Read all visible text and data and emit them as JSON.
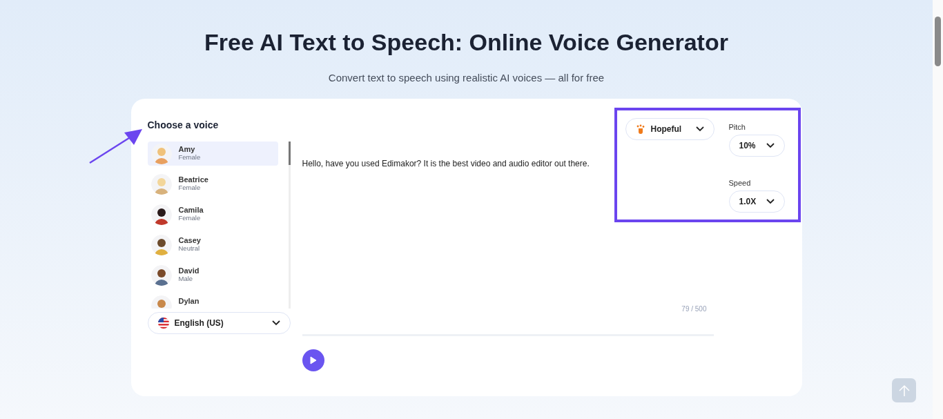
{
  "header": {
    "title": "Free AI Text to Speech: Online Voice Generator",
    "subtitle": "Convert text to speech using realistic AI voices — all for free"
  },
  "voice_panel": {
    "heading": "Choose a voice",
    "voices": [
      {
        "name": "Amy",
        "gender": "Female",
        "selected": true
      },
      {
        "name": "Beatrice",
        "gender": "Female",
        "selected": false
      },
      {
        "name": "Camila",
        "gender": "Female",
        "selected": false
      },
      {
        "name": "Casey",
        "gender": "Neutral",
        "selected": false
      },
      {
        "name": "David",
        "gender": "Male",
        "selected": false
      },
      {
        "name": "Dylan",
        "selected": false
      }
    ],
    "language": "English (US)"
  },
  "editor": {
    "text": "Hello, have you used Edimakor? It is the best video and audio editor out there.",
    "counter": "79 / 500"
  },
  "settings": {
    "emotion": "Hopeful",
    "pitch_label": "Pitch",
    "pitch": "10%",
    "speed_label": "Speed",
    "speed": "1.0X"
  }
}
